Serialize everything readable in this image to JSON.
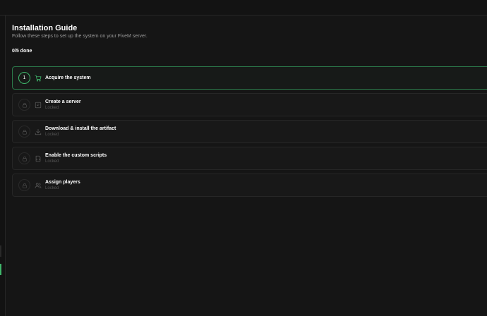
{
  "header": {
    "title": "Installation Guide",
    "subtitle": "Follow these steps to set up the system on your FiveM server.",
    "progress": "0/5 done"
  },
  "colors": {
    "accent": "#3fb66b",
    "background": "#151515",
    "card": "#181818",
    "muted": "#555555"
  },
  "steps": [
    {
      "number": "1",
      "icon": "cart-icon",
      "label": "Acquire the system",
      "status": "",
      "state": "active"
    },
    {
      "number": "",
      "icon": "server-icon",
      "label": "Create a server",
      "status": "Locked",
      "state": "locked"
    },
    {
      "number": "",
      "icon": "download-icon",
      "label": "Download & install the artifact",
      "status": "Locked",
      "state": "locked"
    },
    {
      "number": "",
      "icon": "script-file-icon",
      "label": "Enable the custom scripts",
      "status": "Locked",
      "state": "locked"
    },
    {
      "number": "",
      "icon": "users-icon",
      "label": "Assign players",
      "status": "Locked",
      "state": "locked"
    }
  ]
}
